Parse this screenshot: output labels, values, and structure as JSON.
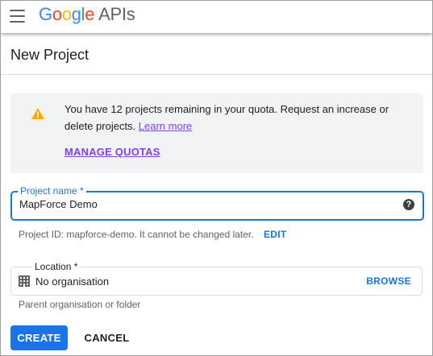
{
  "topbar": {
    "logo_letters": [
      "G",
      "o",
      "o",
      "g",
      "l",
      "e"
    ],
    "logo_suffix": "APIs"
  },
  "header": {
    "title": "New Project"
  },
  "notice": {
    "text": "You have 12 projects remaining in your quota. Request an increase or delete projects. ",
    "link": "Learn more",
    "action": "MANAGE QUOTAS",
    "icon": "warning-icon",
    "icon_color": "#f9ab00"
  },
  "project_name": {
    "label": "Project name *",
    "value": "MapForce Demo",
    "help_icon": "?"
  },
  "project_id": {
    "text": "Project ID: mapforce-demo. It cannot be changed later.",
    "edit": "EDIT"
  },
  "location": {
    "label": "Location *",
    "value": "No organisation",
    "browse": "BROWSE",
    "helper": "Parent organisation or folder",
    "icon": "building-icon"
  },
  "actions": {
    "create": "CREATE",
    "cancel": "CANCEL"
  },
  "colors": {
    "primary": "#1a73e8",
    "link": "#7e3ff2",
    "notice_bg": "#f1f3f4"
  }
}
